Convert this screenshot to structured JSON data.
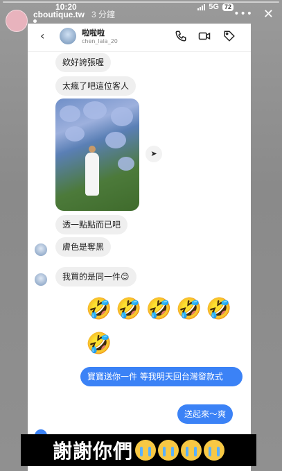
{
  "status_bar": {
    "time": "10:20",
    "network": "5G",
    "battery": "72"
  },
  "story": {
    "username": "cboutique.tw",
    "time_ago": "3 分鐘",
    "subtitle": "",
    "avatar_text": ""
  },
  "chat": {
    "contact_name": "啦啦啦",
    "contact_handle": "chen_lala_20",
    "messages": [
      {
        "text": "欸好誇張喔",
        "direction": "in"
      },
      {
        "text": "太瘋了吧這位客人",
        "direction": "in"
      },
      {
        "text": "透一點點而已吧",
        "direction": "in"
      },
      {
        "text": "膚色是奪黑",
        "direction": "in"
      },
      {
        "text": "我買的是同一件😊",
        "direction": "in"
      },
      {
        "text": "寶寶送你一件 等我明天回台灣發款式",
        "direction": "out"
      },
      {
        "text": "送起來～爽",
        "direction": "out"
      }
    ],
    "emoji_row_1": "🤣🤣🤣🤣🤣",
    "emoji_row_2": "🤣"
  },
  "caption": {
    "text": "謝謝你們"
  },
  "icons": [
    "back-arrow-icon",
    "phone-icon",
    "video-icon",
    "tag-icon",
    "share-arrow-icon",
    "cry-emoji-icon"
  ],
  "colors": {
    "outgoing_bubble": "#3b82f6",
    "incoming_bubble": "#efefef",
    "caption_bg": "#000000"
  }
}
